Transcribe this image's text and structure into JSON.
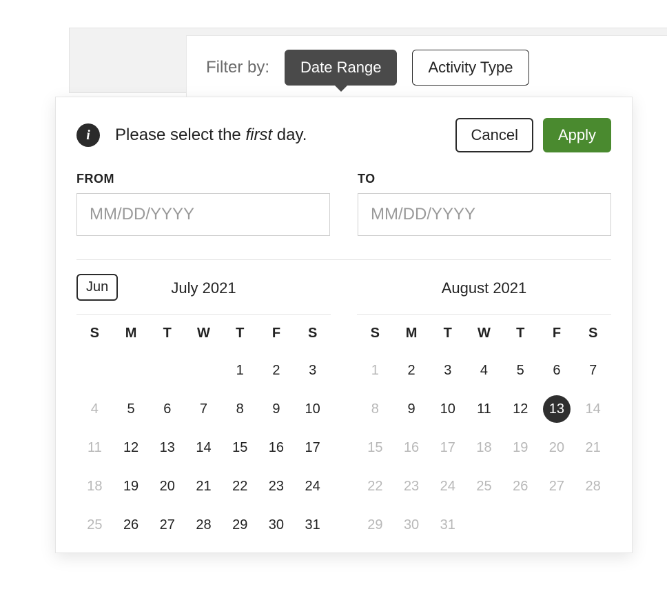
{
  "filter": {
    "label": "Filter by:",
    "date_range_label": "Date Range",
    "activity_type_label": "Activity Type"
  },
  "instruction": {
    "prefix": "Please select the ",
    "em": "first",
    "suffix": " day."
  },
  "buttons": {
    "cancel": "Cancel",
    "apply": "Apply"
  },
  "range": {
    "from_label": "FROM",
    "to_label": "TO",
    "from_value": "",
    "to_value": "",
    "placeholder": "MM/DD/YYYY"
  },
  "prev_month_label": "Jun",
  "weekdays": [
    "S",
    "M",
    "T",
    "W",
    "T",
    "F",
    "S"
  ],
  "calendars": [
    {
      "title": "July 2021",
      "lead_blanks": 4,
      "days": [
        {
          "n": 1
        },
        {
          "n": 2
        },
        {
          "n": 3
        },
        {
          "n": 4,
          "dis": true
        },
        {
          "n": 5
        },
        {
          "n": 6
        },
        {
          "n": 7
        },
        {
          "n": 8
        },
        {
          "n": 9
        },
        {
          "n": 10
        },
        {
          "n": 11,
          "dis": true
        },
        {
          "n": 12
        },
        {
          "n": 13
        },
        {
          "n": 14
        },
        {
          "n": 15
        },
        {
          "n": 16
        },
        {
          "n": 17
        },
        {
          "n": 18,
          "dis": true
        },
        {
          "n": 19
        },
        {
          "n": 20
        },
        {
          "n": 21
        },
        {
          "n": 22
        },
        {
          "n": 23
        },
        {
          "n": 24
        },
        {
          "n": 25,
          "dis": true
        },
        {
          "n": 26
        },
        {
          "n": 27
        },
        {
          "n": 28
        },
        {
          "n": 29
        },
        {
          "n": 30
        },
        {
          "n": 31
        }
      ]
    },
    {
      "title": "August 2021",
      "lead_blanks": 0,
      "days": [
        {
          "n": 1,
          "dis": true
        },
        {
          "n": 2
        },
        {
          "n": 3
        },
        {
          "n": 4
        },
        {
          "n": 5
        },
        {
          "n": 6
        },
        {
          "n": 7
        },
        {
          "n": 8,
          "dis": true
        },
        {
          "n": 9
        },
        {
          "n": 10
        },
        {
          "n": 11
        },
        {
          "n": 12
        },
        {
          "n": 13,
          "today": true
        },
        {
          "n": 14,
          "dis": true
        },
        {
          "n": 15,
          "dis": true
        },
        {
          "n": 16,
          "dis": true
        },
        {
          "n": 17,
          "dis": true
        },
        {
          "n": 18,
          "dis": true
        },
        {
          "n": 19,
          "dis": true
        },
        {
          "n": 20,
          "dis": true
        },
        {
          "n": 21,
          "dis": true
        },
        {
          "n": 22,
          "dis": true
        },
        {
          "n": 23,
          "dis": true
        },
        {
          "n": 24,
          "dis": true
        },
        {
          "n": 25,
          "dis": true
        },
        {
          "n": 26,
          "dis": true
        },
        {
          "n": 27,
          "dis": true
        },
        {
          "n": 28,
          "dis": true
        },
        {
          "n": 29,
          "dis": true
        },
        {
          "n": 30,
          "dis": true
        },
        {
          "n": 31,
          "dis": true
        }
      ]
    }
  ]
}
